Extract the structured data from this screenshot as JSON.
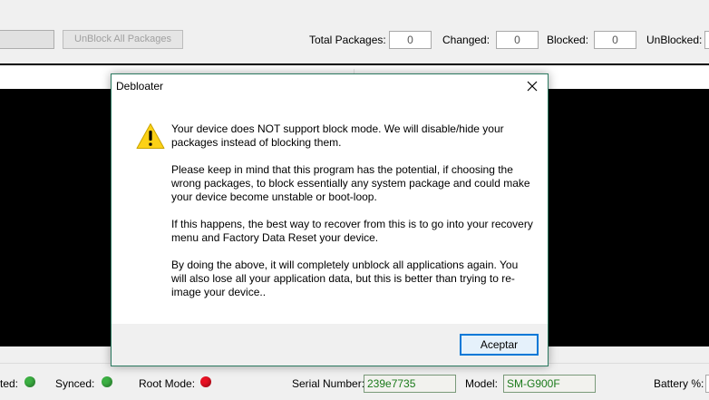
{
  "toolbar": {
    "unblock_all_label": "UnBlock All Packages",
    "total_packages_label": "Total Packages:",
    "total_packages_value": "0",
    "changed_label": "Changed:",
    "changed_value": "0",
    "blocked_label": "Blocked:",
    "blocked_value": "0",
    "unblocked_label": "UnBlocked:"
  },
  "status": {
    "connected_label": "ted:",
    "synced_label": "Synced:",
    "root_mode_label": "Root Mode:",
    "serial_label": "Serial Number:",
    "serial_value": "239e7735",
    "model_label": "Model:",
    "model_value": "SM-G900F",
    "battery_label": "Battery %:",
    "colors": {
      "connected": "#3cb043",
      "synced": "#3cb043",
      "root_mode": "#e81123"
    }
  },
  "dialog": {
    "title": "Debloater",
    "close_icon": "close-icon",
    "warning_icon": "warning-icon",
    "paragraph_1": "Your device does NOT support block mode.  We will disable/hide your packages instead of blocking them.",
    "paragraph_2": "Please keep in mind that this program has the potential, if choosing the wrong packages, to block essentially any system package and could make your device become unstable or boot-loop.",
    "paragraph_3": "If this happens, the best way to recover from this is to go into your recovery menu and Factory Data Reset your device.",
    "paragraph_4": "By doing the above, it will completely unblock all applications again. You will also lose all your application data, but this is better than trying to re-image your device..",
    "ok_label": "Aceptar"
  }
}
